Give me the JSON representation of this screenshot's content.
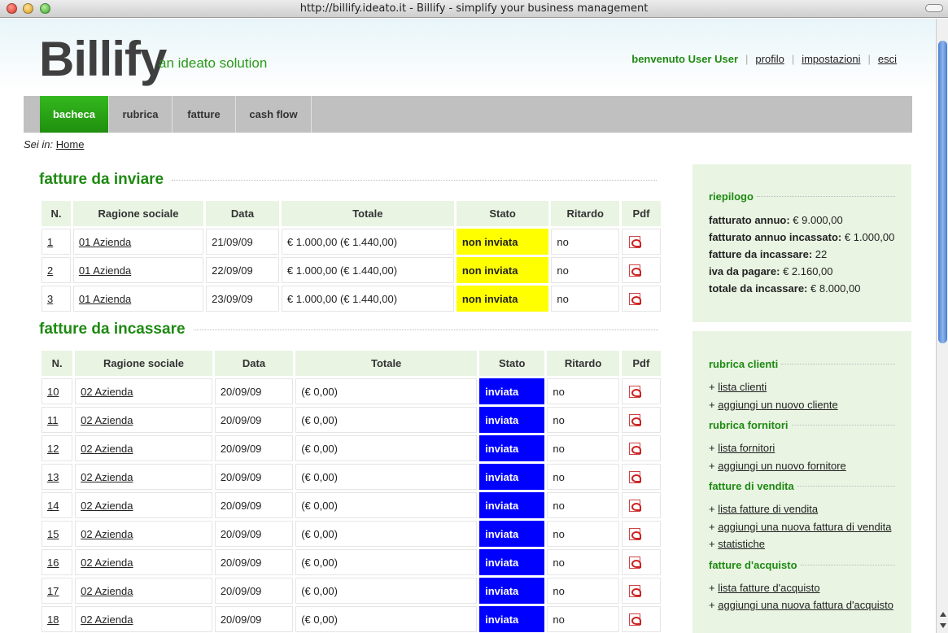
{
  "window": {
    "title": "http://billify.ideato.it - Billify - simplify your business management"
  },
  "header": {
    "logo": "Billify",
    "tagline": "an ideato solution",
    "welcome": "benvenuto User User",
    "links": [
      "profilo",
      "impostazioni",
      "esci"
    ]
  },
  "nav": {
    "tabs": [
      "bacheca",
      "rubrica",
      "fatture",
      "cash flow"
    ],
    "active": "bacheca"
  },
  "breadcrumb": {
    "prefix": "Sei in:",
    "home": "Home"
  },
  "inviare": {
    "title": "fatture da inviare",
    "columns": [
      "N.",
      "Ragione sociale",
      "Data",
      "Totale",
      "Stato",
      "Ritardo",
      "Pdf"
    ],
    "rows": [
      {
        "n": "1",
        "ragione": "01 Azienda",
        "data": "21/09/09",
        "totale": "€ 1.000,00 (€ 1.440,00)",
        "stato": "non inviata",
        "ritardo": "no"
      },
      {
        "n": "2",
        "ragione": "01 Azienda",
        "data": "22/09/09",
        "totale": "€ 1.000,00 (€ 1.440,00)",
        "stato": "non inviata",
        "ritardo": "no"
      },
      {
        "n": "3",
        "ragione": "01 Azienda",
        "data": "23/09/09",
        "totale": "€ 1.000,00 (€ 1.440,00)",
        "stato": "non inviata",
        "ritardo": "no"
      }
    ]
  },
  "incassare": {
    "title": "fatture da incassare",
    "columns": [
      "N.",
      "Ragione sociale",
      "Data",
      "Totale",
      "Stato",
      "Ritardo",
      "Pdf"
    ],
    "rows": [
      {
        "n": "10",
        "ragione": "02 Azienda",
        "data": "20/09/09",
        "totale": "(€ 0,00)",
        "stato": "inviata",
        "ritardo": "no"
      },
      {
        "n": "11",
        "ragione": "02 Azienda",
        "data": "20/09/09",
        "totale": "(€ 0,00)",
        "stato": "inviata",
        "ritardo": "no"
      },
      {
        "n": "12",
        "ragione": "02 Azienda",
        "data": "20/09/09",
        "totale": "(€ 0,00)",
        "stato": "inviata",
        "ritardo": "no"
      },
      {
        "n": "13",
        "ragione": "02 Azienda",
        "data": "20/09/09",
        "totale": "(€ 0,00)",
        "stato": "inviata",
        "ritardo": "no"
      },
      {
        "n": "14",
        "ragione": "02 Azienda",
        "data": "20/09/09",
        "totale": "(€ 0,00)",
        "stato": "inviata",
        "ritardo": "no"
      },
      {
        "n": "15",
        "ragione": "02 Azienda",
        "data": "20/09/09",
        "totale": "(€ 0,00)",
        "stato": "inviata",
        "ritardo": "no"
      },
      {
        "n": "16",
        "ragione": "02 Azienda",
        "data": "20/09/09",
        "totale": "(€ 0,00)",
        "stato": "inviata",
        "ritardo": "no"
      },
      {
        "n": "17",
        "ragione": "02 Azienda",
        "data": "20/09/09",
        "totale": "(€ 0,00)",
        "stato": "inviata",
        "ritardo": "no"
      },
      {
        "n": "18",
        "ragione": "02 Azienda",
        "data": "20/09/09",
        "totale": "(€ 0,00)",
        "stato": "inviata",
        "ritardo": "no"
      }
    ]
  },
  "riepilogo": {
    "title": "riepilogo",
    "items": [
      {
        "label": "fatturato annuo:",
        "value": "€ 9.000,00"
      },
      {
        "label": "fatturato annuo incassato:",
        "value": "€ 1.000,00"
      },
      {
        "label": "fatture da incassare:",
        "value": "22"
      },
      {
        "label": "iva da pagare:",
        "value": "€ 2.160,00"
      },
      {
        "label": "totale da incassare:",
        "value": "€ 8.000,00"
      }
    ]
  },
  "quicklinks": [
    {
      "title": "rubrica clienti",
      "links": [
        "lista clienti",
        "aggiungi un nuovo cliente"
      ]
    },
    {
      "title": "rubrica fornitori",
      "links": [
        "lista fornitori",
        "aggiungi un nuovo fornitore"
      ]
    },
    {
      "title": "fatture di vendita",
      "links": [
        "lista fatture di vendita",
        "aggiungi una nuova fattura di vendita",
        "statistiche"
      ]
    },
    {
      "title": "fatture d'acquisto",
      "links": [
        "lista fatture d'acquisto",
        "aggiungi una nuova fattura d'acquisto"
      ]
    }
  ],
  "colors": {
    "brand_green": "#1e8a12",
    "non_inviata": "#ffff00",
    "inviata": "#0000ff",
    "panel": "#e9f4e3"
  }
}
